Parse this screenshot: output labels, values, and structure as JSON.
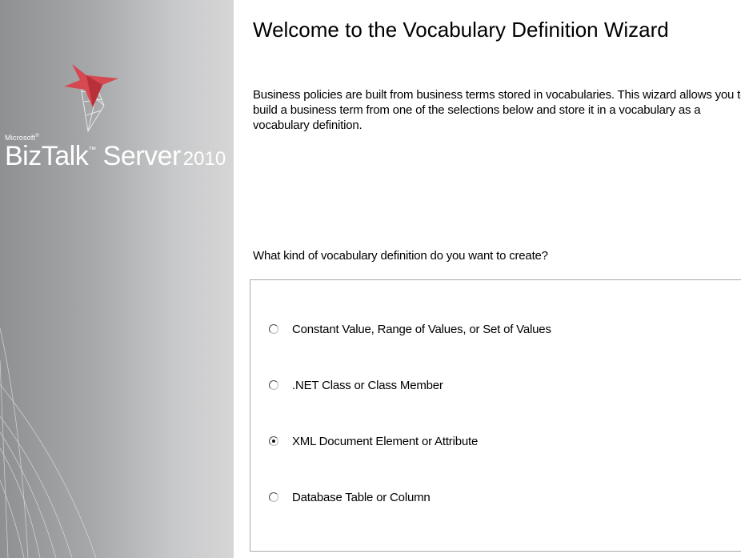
{
  "brand": {
    "company": "Microsoft",
    "product": "BizTalk",
    "product_suffix": "Server",
    "year": "2010"
  },
  "header": {
    "title": "Welcome to the Vocabulary Definition Wizard",
    "description": "Business policies are built from business terms stored in vocabularies. This wizard allows you to build a business term from one of the selections below and store it in a vocabulary as a vocabulary definition."
  },
  "question": "What kind of vocabulary definition do you want to create?",
  "options": [
    {
      "label": "Constant Value, Range of Values, or Set of Values",
      "selected": false
    },
    {
      "label": ".NET Class or Class Member",
      "selected": false
    },
    {
      "label": "XML Document Element or Attribute",
      "selected": true
    },
    {
      "label": "Database Table or Column",
      "selected": false
    }
  ],
  "colors": {
    "logo_red": "#d9434b",
    "sidebar_gray": "#a7a8aa"
  }
}
